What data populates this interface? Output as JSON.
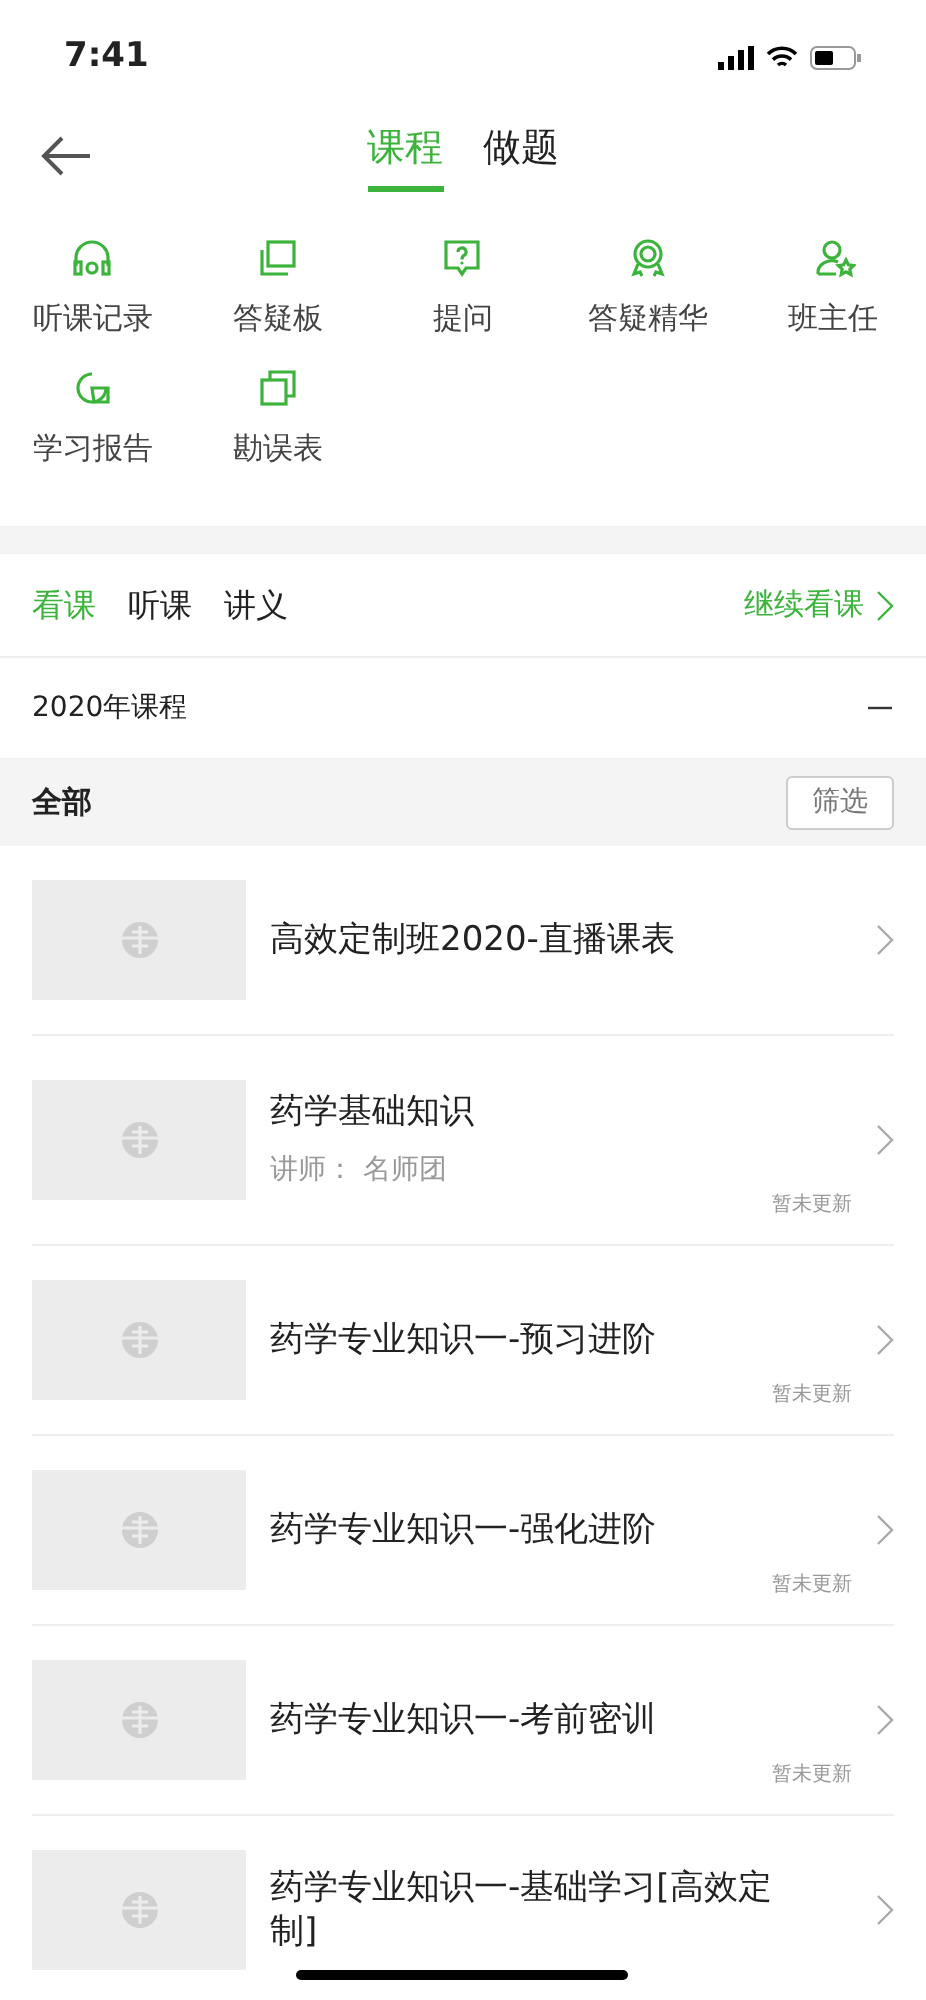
{
  "status_bar": {
    "time": "7:41"
  },
  "header": {
    "tabs": [
      {
        "label": "课程",
        "selected": true
      },
      {
        "label": "做题",
        "selected": false
      }
    ]
  },
  "shortcuts": [
    {
      "kind": "headphones",
      "label": "听课记录"
    },
    {
      "kind": "board",
      "label": "答疑板"
    },
    {
      "kind": "question",
      "label": "提问"
    },
    {
      "kind": "medal",
      "label": "答疑精华"
    },
    {
      "kind": "teacher",
      "label": "班主任"
    },
    {
      "kind": "report",
      "label": "学习报告"
    },
    {
      "kind": "copy",
      "label": "勘误表"
    }
  ],
  "sub_tabs": [
    {
      "label": "看课",
      "selected": true
    },
    {
      "label": "听课",
      "selected": false
    },
    {
      "label": "讲义",
      "selected": false
    }
  ],
  "continue_link": "继续看课",
  "section": {
    "title": "2020年课程",
    "expanded": true
  },
  "filter_bar": {
    "label": "全部",
    "button": "筛选"
  },
  "courses": [
    {
      "title": "高效定制班2020-直播课表"
    },
    {
      "title": "药学基础知识",
      "lecturer": "讲师：  名师团",
      "status": "暂未更新"
    },
    {
      "title": "药学专业知识一-预习进阶",
      "status": "暂未更新"
    },
    {
      "title": "药学专业知识一-强化进阶",
      "status": "暂未更新"
    },
    {
      "title": "药学专业知识一-考前密训",
      "status": "暂未更新"
    },
    {
      "title": "药学专业知识一-基础学习[高效定制]"
    }
  ]
}
